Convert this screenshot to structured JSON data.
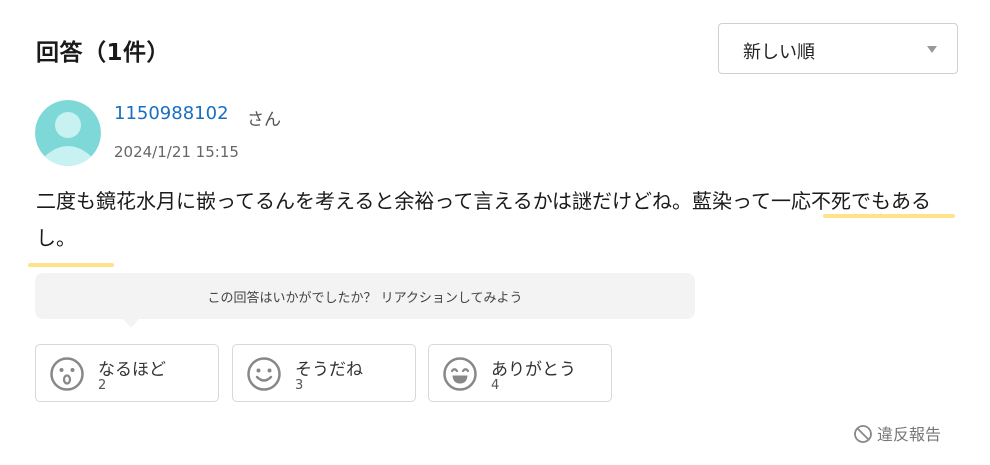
{
  "header": {
    "title": "回答（1件）"
  },
  "sort": {
    "selected": "新しい順"
  },
  "answer": {
    "username": "1150988102",
    "user_suffix": "さん",
    "timestamp": "2024/1/21 15:15",
    "text": "二度も鏡花水月に嵌ってるんを考えると余裕って言えるかは謎だけどね。藍染って一応不死でもあるし。",
    "highlight_color": "#ffe28a"
  },
  "reaction_prompt": "この回答はいかがでしたか？ リアクションしてみよう",
  "reactions": [
    {
      "label": "なるほど",
      "count": "2",
      "icon": "surprised-face-icon"
    },
    {
      "label": "そうだね",
      "count": "3",
      "icon": "smile-face-icon"
    },
    {
      "label": "ありがとう",
      "count": "4",
      "icon": "grin-face-icon"
    }
  ],
  "report": {
    "label": "違反報告",
    "icon": "prohibited-icon"
  },
  "colors": {
    "link": "#1a6ec0",
    "avatar_bg": "#7fd8d8"
  }
}
